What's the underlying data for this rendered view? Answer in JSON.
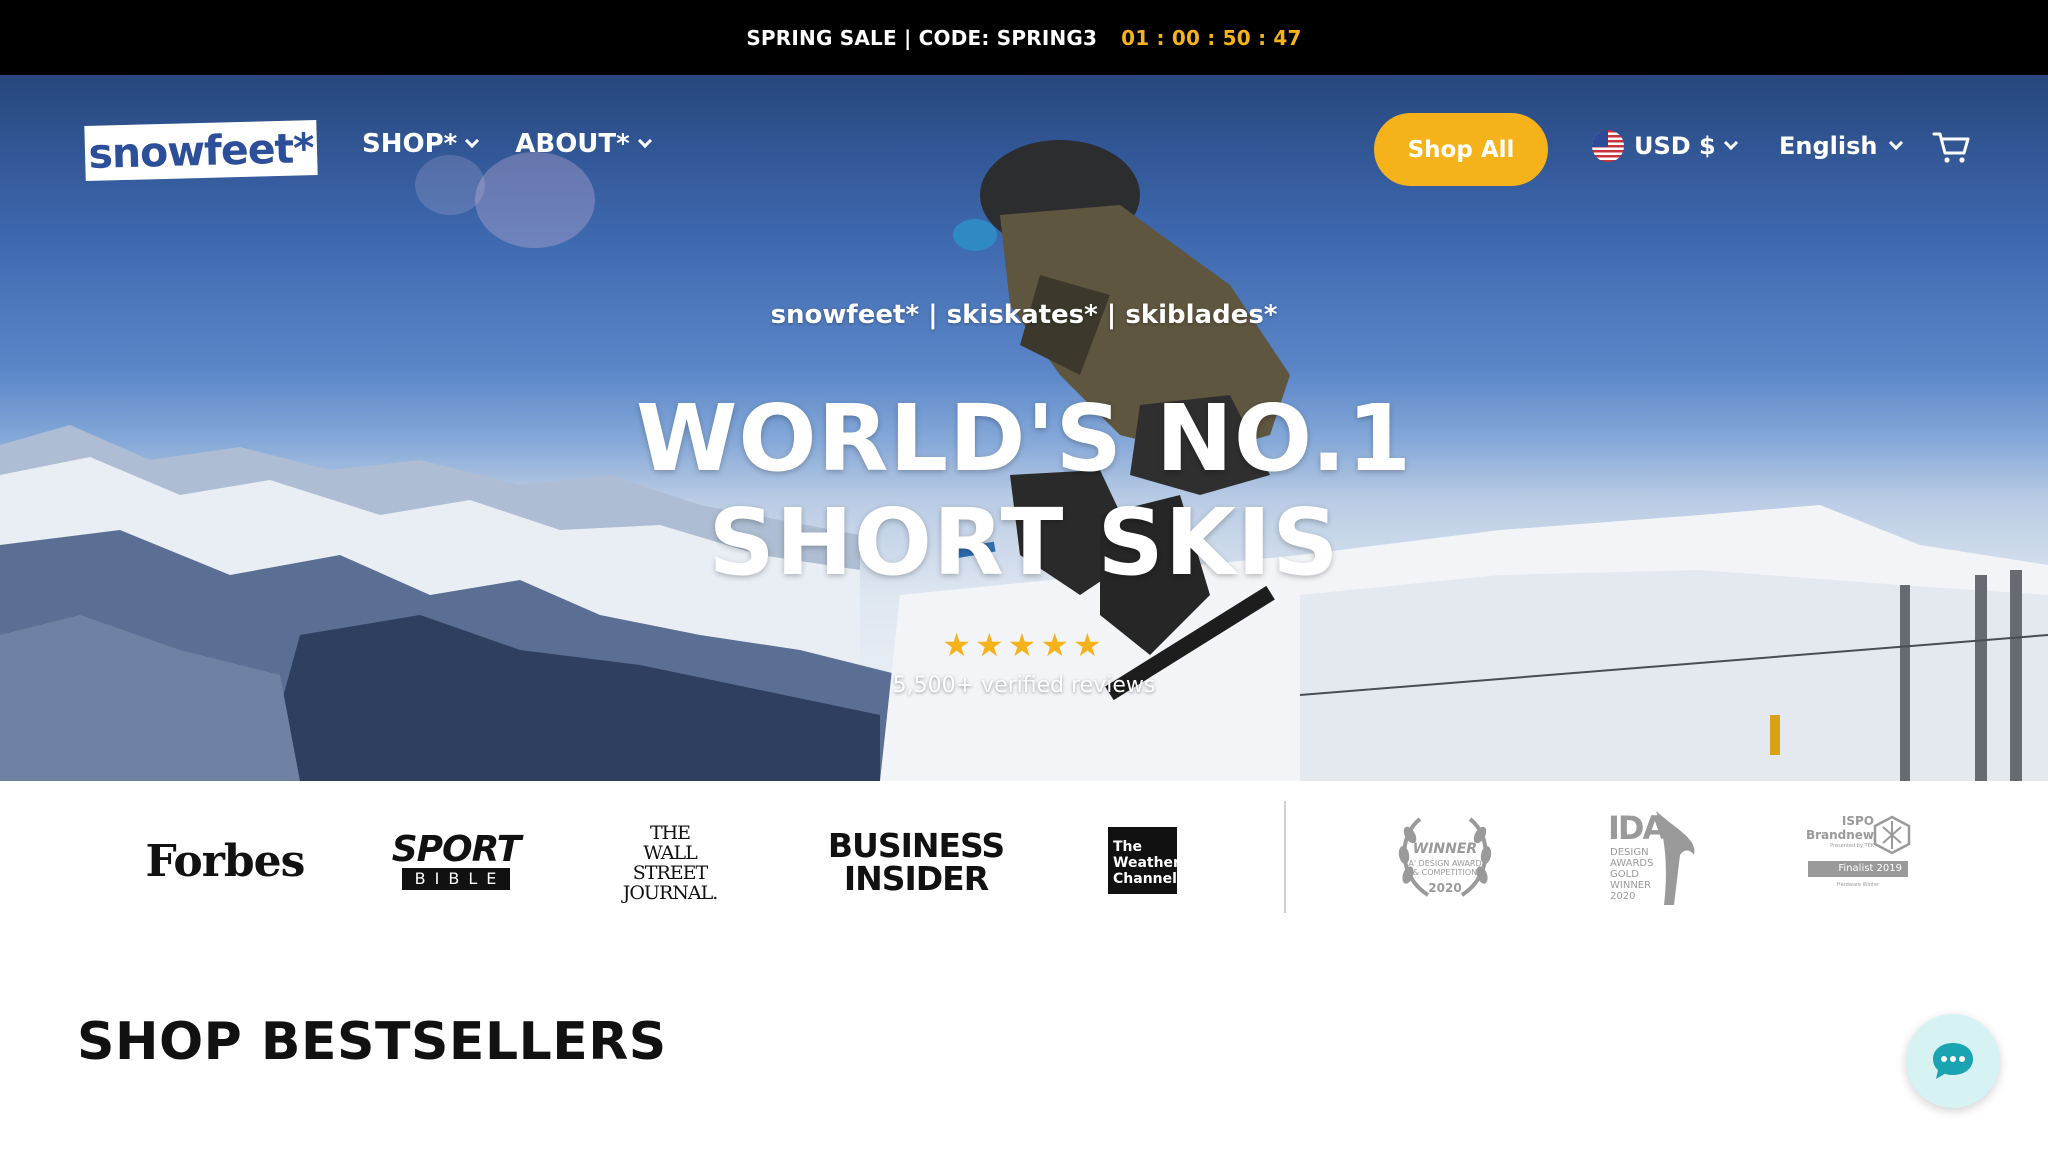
{
  "announcement": {
    "text": "SPRING SALE | CODE: SPRING3",
    "countdown": "01 : 00 : 50 : 47"
  },
  "header": {
    "logo_text": "snowfeet*",
    "nav": [
      {
        "label": "SHOP*"
      },
      {
        "label": "ABOUT*"
      }
    ],
    "shop_all_label": "Shop All",
    "currency": "USD $",
    "language": "English"
  },
  "hero": {
    "tagline": "snowfeet* | skiskates* | skiblades*",
    "headline_line1": "WORLD'S NO.1",
    "headline_line2": "SHORT SKIS",
    "rating": 5,
    "stars": "★★★★★",
    "reviews_text": "5,500+ verified reviews"
  },
  "press": {
    "forbes": "Forbes",
    "sportbible_top": "SPORT",
    "sportbible_bottom": "BIBLE",
    "wsj_1": "THE",
    "wsj_2": "WALL STREET",
    "wsj_3": "JOURNAL.",
    "bi_1": "BUSINESS",
    "bi_2": "INSIDER",
    "weather": [
      "The",
      "Weather",
      "Channel"
    ]
  },
  "awards": {
    "winner_title": "WINNER",
    "winner_sub_1": "A' DESIGN AWARD",
    "winner_sub_2": "& COMPETITION",
    "winner_year": "2020",
    "ida_big": "IDA",
    "ida_small": [
      "DESIGN",
      "AWARDS",
      "GOLD",
      "WINNER",
      "2020"
    ],
    "ispo_1": "ISPO",
    "ispo_2": "Brandnew",
    "ispo_3": "Presented by TEK",
    "ispo_bar": "Finalist 2019",
    "ispo_4": "Hardware Winter"
  },
  "sections": {
    "bestsellers_title": "SHOP BESTSELLERS"
  },
  "colors": {
    "accent": "#f5b21b",
    "brand_blue": "#2d4f9a",
    "chat_bg": "#d7f2f3",
    "chat_icon": "#1aa3b0"
  },
  "icons": [
    "chevron-down-icon",
    "us-flag-icon",
    "cart-icon",
    "star-icon",
    "chat-icon",
    "laurel-icon"
  ]
}
